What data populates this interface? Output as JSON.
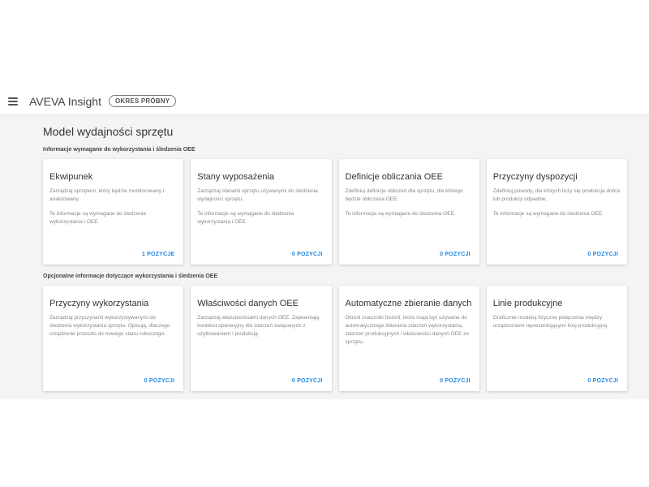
{
  "header": {
    "app_title": "AVEVA Insight",
    "trial_badge": "OKRES PRÓBNY"
  },
  "page": {
    "title": "Model wydajności sprzętu"
  },
  "required_section": {
    "title": "Informacje wymagane do wykorzystania i śledzenia OEE",
    "cards": [
      {
        "title": "Ekwipunek",
        "desc": "Zarządzaj sprzętem, który będzie monitorowany i analizowany.",
        "note": "Te informacje są wymagane do śledzenia wykorzystania i OEE.",
        "action": "1 POZYCJE"
      },
      {
        "title": "Stany wyposażenia",
        "desc": "Zarządzaj stanami sprzętu używanymi do śledzenia wydajności sprzętu.",
        "note": "Te informacje są wymagane do śledzenia wykorzystania i OEE.",
        "action": "0 POZYCJI"
      },
      {
        "title": "Definicje obliczania OEE",
        "desc": "Zdefiniuj definicje obliczeń dla sprzętu, dla którego będzie obliczana OEE.",
        "note": "Te informacje są wymagane do śledzenia OEE.",
        "action": "0 POZYCJI"
      },
      {
        "title": "Przyczyny dyspozycji",
        "desc": "Zdefiniuj powody, dla których liczy się produkcja dobra lub produkcji odpadów.",
        "note": "Te informacje są wymagane do śledzenia OEE.",
        "action": "0 POZYCJI"
      }
    ]
  },
  "optional_section": {
    "title": "Opcjonalne informacje dotyczące wykorzystania i śledzenia OEE",
    "cards": [
      {
        "title": "Przyczyny wykorzystania",
        "desc": "Zarządzaj przyczynami wykorzystywanymi do śledzenia wykorzystania sprzętu. Opisują, dlaczego urządzenie przeszło do nowego stanu roboczego.",
        "action": "0 POZYCJI"
      },
      {
        "title": "Właściwości danych OEE",
        "desc": "Zarządzaj właściwościami danych OEE. Zapewniają kontekst operacyjny dla zdarzeń związanych z użytkowaniem i produkcją.",
        "action": "0 POZYCJI"
      },
      {
        "title": "Automatyczne zbieranie danych",
        "desc": "Określ znaczniki historii, które mają być używane do automatycznego zbierania zdarzeń wykorzystania, zdarzeń produkcyjnych i właściwości danych OEE ze sprzętu.",
        "action": "0 POZYCJI"
      },
      {
        "title": "Linie produkcyjne",
        "desc": "Graficznie modeluj fizyczne połączenia między urządzeniami reprezentującymi linię produkcyjną.",
        "action": "0 POZYCJI"
      }
    ]
  }
}
